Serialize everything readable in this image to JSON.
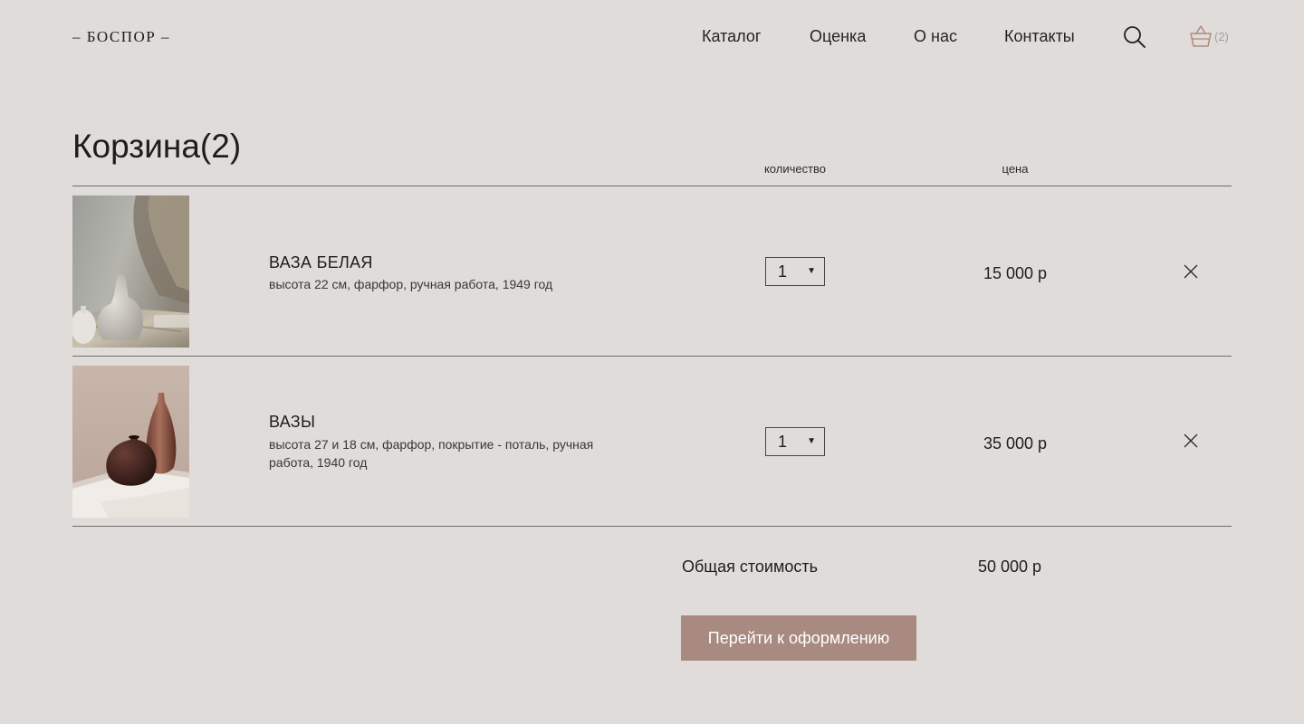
{
  "header": {
    "logo": "– БОСПОР –",
    "nav": [
      {
        "label": "Каталог"
      },
      {
        "label": "Оценка"
      },
      {
        "label": "О нас"
      },
      {
        "label": "Контакты"
      }
    ],
    "basket_count": "(2)",
    "icons": {
      "search": "search-icon",
      "basket": "basket-icon"
    },
    "colors": {
      "basket_icon": "#b0897e"
    }
  },
  "cart": {
    "title": "Корзина(2)",
    "columns": {
      "quantity": "количество",
      "price": "цена"
    },
    "items": [
      {
        "name": "ВАЗА БЕЛАЯ",
        "description": "высота 22 см, фарфор, ручная работа, 1949 год",
        "quantity": "1",
        "price": "15 000 р"
      },
      {
        "name": "ВАЗЫ",
        "description": "высота 27 и 18 см, фарфор, покрытие - поталь, ручная работа, 1940 год",
        "quantity": "1",
        "price": "35 000 р"
      }
    ],
    "total_label": "Общая стоимость",
    "total_value": "50 000 р",
    "checkout_label": "Перейти к оформлению"
  },
  "colors": {
    "background": "#e0dcd9",
    "accent_button": "#a98a81",
    "divider": "#6f6b68"
  }
}
